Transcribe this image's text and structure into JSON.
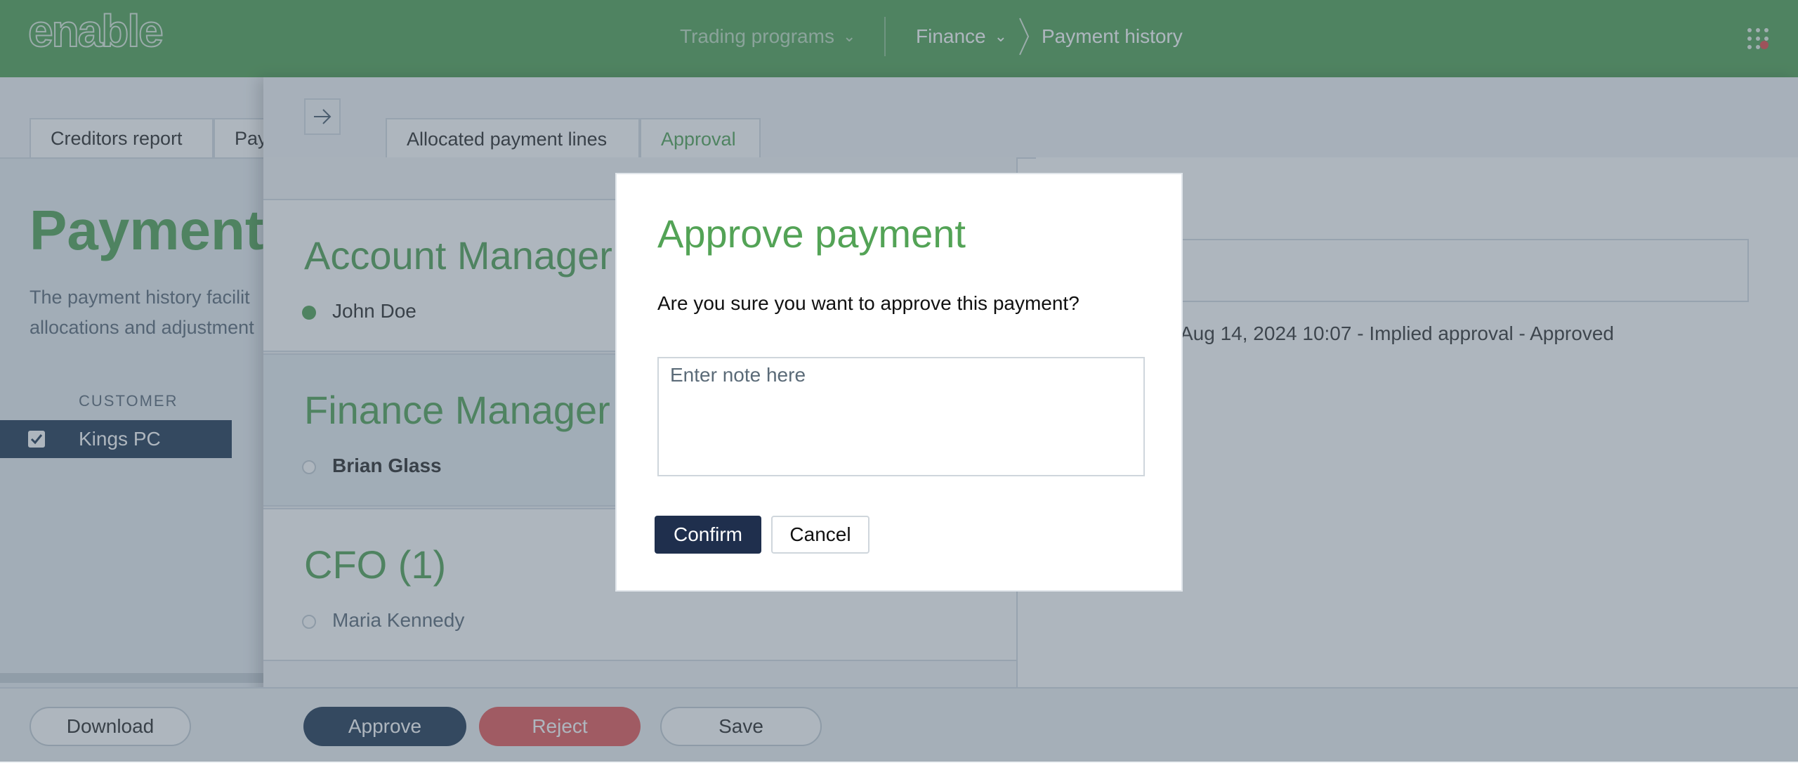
{
  "app": {
    "logo_text": "enable",
    "nav": {
      "trading_programs": "Trading programs",
      "finance": "Finance",
      "payment_history": "Payment history"
    },
    "icons": {
      "apps": "apps-grid-icon",
      "chevron": "chevron-down-icon",
      "breadcrumb": "breadcrumb-chevron-icon"
    },
    "colors": {
      "brand": "#53a356",
      "navy": "#223a55",
      "reject": "#e55a5a",
      "notification": "#e14b4b"
    }
  },
  "page": {
    "tabs": [
      "Creditors report",
      "Pay"
    ],
    "title": "Payment",
    "description_line1": "The payment history facilit",
    "description_line2": "allocations and adjustment",
    "customer_header": "CUSTOMER",
    "customer_name": "Kings PC",
    "buttons": {
      "download": "Download",
      "approve": "Approve",
      "reject": "Reject",
      "save": "Save"
    }
  },
  "panel": {
    "tabs": {
      "allocated": "Allocated payment lines",
      "approval": "Approval"
    },
    "stages": [
      {
        "title": "Account Manager",
        "person": "John Doe"
      },
      {
        "title": "Finance Manager",
        "person": "Brian Glass"
      },
      {
        "title": "CFO (1)",
        "person": "Maria Kennedy"
      }
    ],
    "history": "Aug 14, 2024 10:07 - Implied approval - Approved"
  },
  "modal": {
    "title": "Approve payment",
    "question": "Are you sure you want to approve this payment?",
    "note_placeholder": "Enter note here",
    "confirm_label": "Confirm",
    "cancel_label": "Cancel"
  }
}
